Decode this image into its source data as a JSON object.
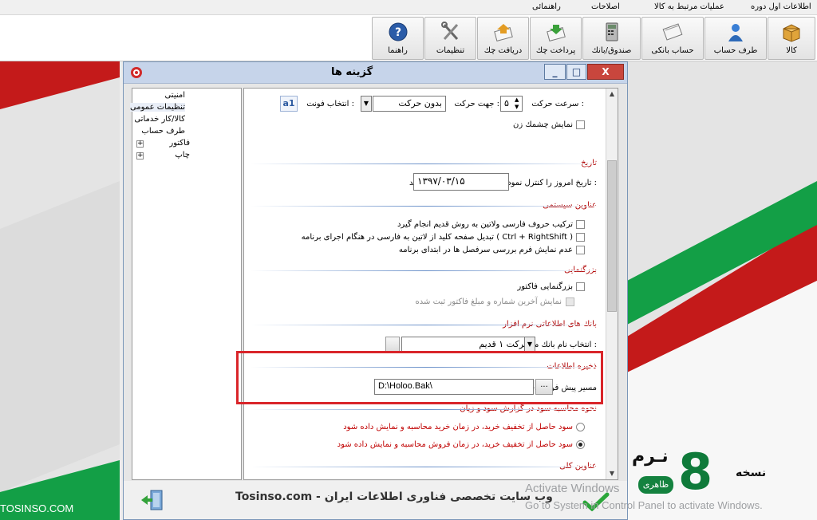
{
  "menu": {
    "items": [
      "اطلاعات اول دوره",
      "عملیات مرتبط به کالا",
      "اصلاحات",
      "راهنمائی"
    ]
  },
  "toolbar": {
    "buttons": [
      {
        "label": "کالا",
        "icon": "box-icon"
      },
      {
        "label": "طرف حساب",
        "icon": "person-icon"
      },
      {
        "label": "حساب بانکی",
        "icon": "bank-card-icon"
      },
      {
        "label": "صندوق/بانك",
        "icon": "calculator-icon"
      },
      {
        "label": "پرداخت چك",
        "icon": "pay-check-icon"
      },
      {
        "label": "دریافت چك",
        "icon": "receive-check-icon"
      },
      {
        "label": "تنظیمات",
        "icon": "tools-icon"
      },
      {
        "label": "راهنما",
        "icon": "help-icon"
      }
    ]
  },
  "dialog": {
    "title": "گزینه ها",
    "window_buttons": [
      "_",
      "□",
      "X"
    ]
  },
  "tree": {
    "items": [
      "امنیتی",
      "تنظیمات عمومی",
      "كالا/كار خدماتی",
      "طرف حساب",
      "فاكتور",
      "چاپ"
    ]
  },
  "settings": {
    "speed_label": "سرعت حركت :",
    "speed_value": "۵",
    "direction_label": "جهت حركت :",
    "direction_value": "بدون حركت",
    "font_label": "انتخاب فونت :",
    "font_icon": "font-picker-icon",
    "blink_label": "نمایش چشمك زن",
    "date_title": "تاریخ",
    "date_label": "تاریخ امروز را كنترل نموده و درصورت نیاز اصلاح نمائید :",
    "date_value": "۱۳۹۷/۰۳/۱۵",
    "system_title": "عناوین سیستمی",
    "sys_opt1": "تركیب حروف فارسی ولاتین به روش قدیم انجام گیرد",
    "sys_opt2": "تبدیل صفحه كلید از لاتین به فارسی در هنگام اجرای برنامه  ( Ctrl + RightShift )",
    "sys_opt3": "عدم نمایش فرم بررسی سرفصل ها در ابتدای برنامه",
    "zoom_title": "بزرگنمایی",
    "zoom_opt1": "بزرگنمایی فاكتور",
    "zoom_opt2": "نمایش آخرین شماره و مبلغ فاكتور ثبت شده",
    "bank_title": "بانك های اطلاعاتی نرم افزار",
    "bank_label": "انتخاب نام بانك مربوطه :",
    "bank_value": "شركت ۱ قدیم",
    "storage_title": "ذخیره اطلاعات",
    "storage_label": "مسیر پیش فرض ذخیره و بازیابی اطلاعات",
    "storage_value": "D:\\Holoo.Bak\\",
    "browse_label": "...",
    "profit_title": "نحوه محاسبه سود در گزارش سود و زیان",
    "profit_opt1": "سود حاصل از تخفیف خرید، در زمان خرید محاسبه و نمایش داده شود",
    "profit_opt2": "سود حاصل از تخفیف خرید، در زمان فروش محاسبه و نمایش داده شود",
    "general_title": "عناوین كلی"
  },
  "footer": {
    "watermark": "Tosinso.com - وب سایت تخصصی فناوری اطلاعات ایران"
  },
  "background": {
    "watermark": "TOSINSO.COM",
    "banner_number": "8",
    "banner_word1": "نسخه",
    "banner_word2": "نـرم",
    "banner_badge": "ظاهری",
    "activate_line1": "Activate Windows",
    "activate_line2": "Go to System in Control Panel to activate Windows."
  },
  "colors": {
    "accent_red": "#d9252a",
    "section_title": "#b00000",
    "banner_green": "#14823f"
  }
}
